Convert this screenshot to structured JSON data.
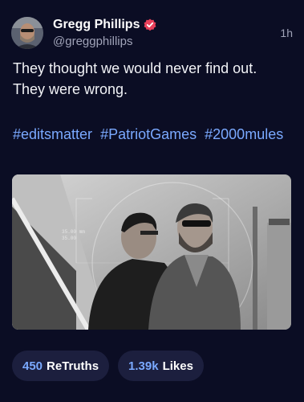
{
  "author": {
    "display_name": "Gregg Phillips",
    "handle": "@greggphillips",
    "verified_icon": "verified-badge-icon",
    "verified_color": "#e8405b"
  },
  "post": {
    "timestamp": "1h",
    "text": "They thought we would never find out. They were wrong.",
    "hashtags": [
      "#editsmatter",
      "#PatriotGames",
      "#2000mules"
    ]
  },
  "media": {
    "description_icon": "video-still-image",
    "overlay_readout_1": "35.00 mm",
    "overlay_readout_2": "35.00"
  },
  "actions": {
    "retruths_count": "450",
    "retruths_label": "ReTruths",
    "likes_count": "1.39k",
    "likes_label": "Likes"
  },
  "colors": {
    "background": "#0b0d24",
    "accent": "#7aa9ff",
    "pill_bg": "#1c1f3e"
  }
}
